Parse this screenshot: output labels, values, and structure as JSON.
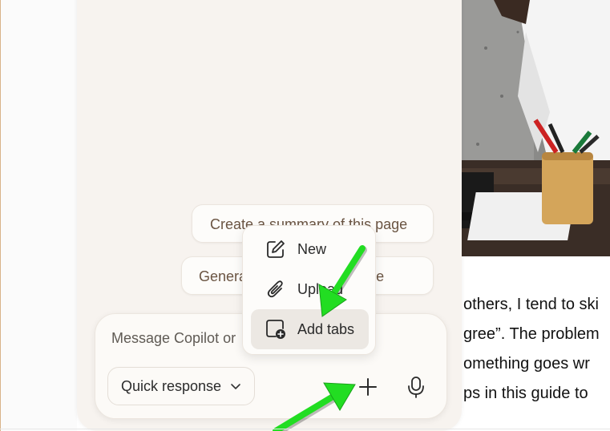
{
  "article": {
    "lines": [
      "others, I tend to ski",
      "gree”. The problem",
      "omething goes wr",
      "ps in this guide to"
    ]
  },
  "copilot": {
    "suggestions": [
      {
        "label": "Create a summary of this page"
      },
      {
        "label": "Generate a quiz on this page"
      }
    ],
    "composer": {
      "placeholder": "Message Copilot or",
      "mode_label": "Quick response"
    },
    "attach_menu": {
      "items": [
        {
          "label": "New",
          "icon": "new-chat-icon"
        },
        {
          "label": "Upload",
          "icon": "paperclip-icon"
        },
        {
          "label": "Add tabs",
          "icon": "add-tabs-icon"
        }
      ]
    }
  },
  "annotations": {
    "arrow_color": "#22dd22"
  }
}
